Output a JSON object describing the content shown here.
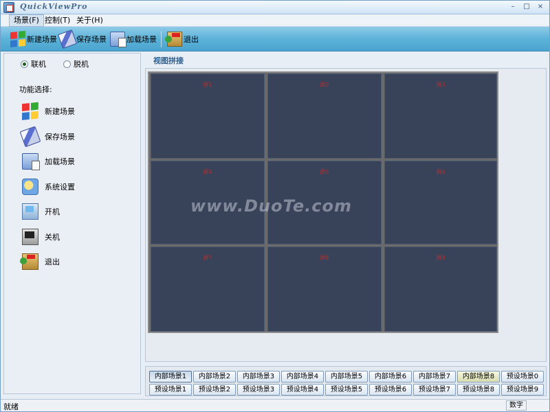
{
  "window": {
    "title": "QuickViewPro",
    "min": "–",
    "max": "□",
    "close": "×"
  },
  "menu": [
    "场景(F)",
    "控制(T)",
    "关于(H)"
  ],
  "toolbar": [
    {
      "label": "新建场景",
      "icon": "new-scene-icon"
    },
    {
      "label": "保存场景",
      "icon": "save-scene-icon"
    },
    {
      "label": "加载场景",
      "icon": "load-scene-icon"
    },
    {
      "label": "退出",
      "icon": "exit-icon"
    }
  ],
  "mode": {
    "online": "联机",
    "offline": "脱机",
    "selected": "online"
  },
  "functions": {
    "title": "功能选择:",
    "items": [
      {
        "label": "新建场景",
        "icon": "new-scene-icon"
      },
      {
        "label": "保存场景",
        "icon": "save-scene-icon"
      },
      {
        "label": "加载场景",
        "icon": "load-scene-icon"
      },
      {
        "label": "系统设置",
        "icon": "settings-icon"
      },
      {
        "label": "开机",
        "icon": "power-on-icon"
      },
      {
        "label": "关机",
        "icon": "power-off-icon"
      },
      {
        "label": "退出",
        "icon": "exit-icon"
      }
    ]
  },
  "view": {
    "title": "视图拼接",
    "cells": [
      "屏1",
      "屏2",
      "屏3",
      "屏4",
      "屏5",
      "屏6",
      "屏7",
      "屏8",
      "屏9"
    ],
    "watermark": "www.DuoTe.com"
  },
  "scenes": {
    "internal": [
      "内部场景1",
      "内部场景2",
      "内部场景3",
      "内部场景4",
      "内部场景5",
      "内部场景6",
      "内部场景7",
      "内部场景8"
    ],
    "preset_row1_extra": "预设场景0",
    "preset": [
      "预设场景1",
      "预设场景2",
      "预设场景3",
      "预设场景4",
      "预设场景5",
      "预设场景6",
      "预设场景7",
      "预设场景8",
      "预设场景9"
    ]
  },
  "status": {
    "left": "就绪",
    "right": "数字"
  },
  "colors": {
    "toolbar": "#5cb2d9",
    "cell": "#38435a",
    "cell_label": "#b03030"
  }
}
